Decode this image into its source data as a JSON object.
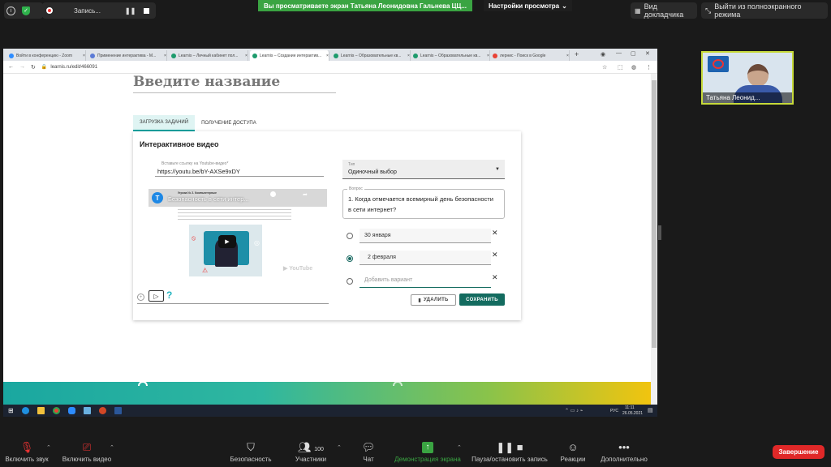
{
  "zoom_top": {
    "recording_label": "Запись...",
    "sharing_banner": "Вы просматриваете экран Татьяна Леонидовна Гальнева ЦЦ...",
    "view_options": "Настройки просмотра",
    "speaker_view": "Вид докладчика",
    "exit_fullscreen": "Выйти из полноэкранного режима"
  },
  "browser": {
    "tabs": [
      {
        "label": "Войти в конференцию - Zoom",
        "color": "#2d8cff"
      },
      {
        "label": "Применение интерактива - M...",
        "color": "#5b7bd6"
      },
      {
        "label": "Learnis – Личный кабинет пол...",
        "color": "#1d9b6c"
      },
      {
        "label": "Learnis – Создание интерактив...",
        "color": "#1d9b6c"
      },
      {
        "label": "Learnis – Образовательные кв...",
        "color": "#1d9b6c"
      },
      {
        "label": "Learnis – Образовательные кв...",
        "color": "#1d9b6c"
      },
      {
        "label": "лернис - Поиск в Google",
        "color": "#e94235"
      }
    ],
    "new_tab": "+",
    "url": "learnis.ru/edit/466091"
  },
  "page": {
    "title_placeholder": "Введите название",
    "tabs": [
      "ЗАГРУЗКА ЗАДАНИЙ",
      "ПОЛУЧЕНИЕ ДОСТУПА"
    ],
    "card_title": "Интерактивное видео",
    "youtube_label": "Вставьте ссылку на Youtube-видео*",
    "youtube_value": "https://youtu.be/bY-AXSe9xDY",
    "video_title": "Безопасность в сети интер...",
    "video_avatar": "T",
    "video_text_small": "Угроза № 2. Компьютерные",
    "youtube_watermark": "YouTube",
    "type_label": "Тип",
    "type_value": "Одиночный выбор",
    "question_label": "Вопрос",
    "question_text": "1.    Когда отмечается всемирный день безопасности в сети интернет?",
    "options": [
      "30 января",
      "2 февраля"
    ],
    "add_option_placeholder": "Добавить вариант",
    "delete_btn": "УДАЛИТЬ",
    "save_btn": "СОХРАНИТЬ",
    "question_mark": "?"
  },
  "taskbar": {
    "lang": "РУС",
    "time": "11:11",
    "date": "26.05.2021"
  },
  "participant": {
    "name": "Татьяна Леонид..."
  },
  "zoom_bottom": {
    "mic": "Включить звук",
    "video": "Включить видео",
    "security": "Безопасность",
    "participants": "Участники",
    "participants_count": "100",
    "chat": "Чат",
    "share": "Демонстрация экрана",
    "pause_record": "Пауза/остановить запись",
    "reactions": "Реакции",
    "more": "Дополнительно",
    "end": "Завершение"
  },
  "colors": {
    "accent_green": "#3aa442",
    "save_btn": "#136b5f",
    "end_btn": "#e02828"
  }
}
